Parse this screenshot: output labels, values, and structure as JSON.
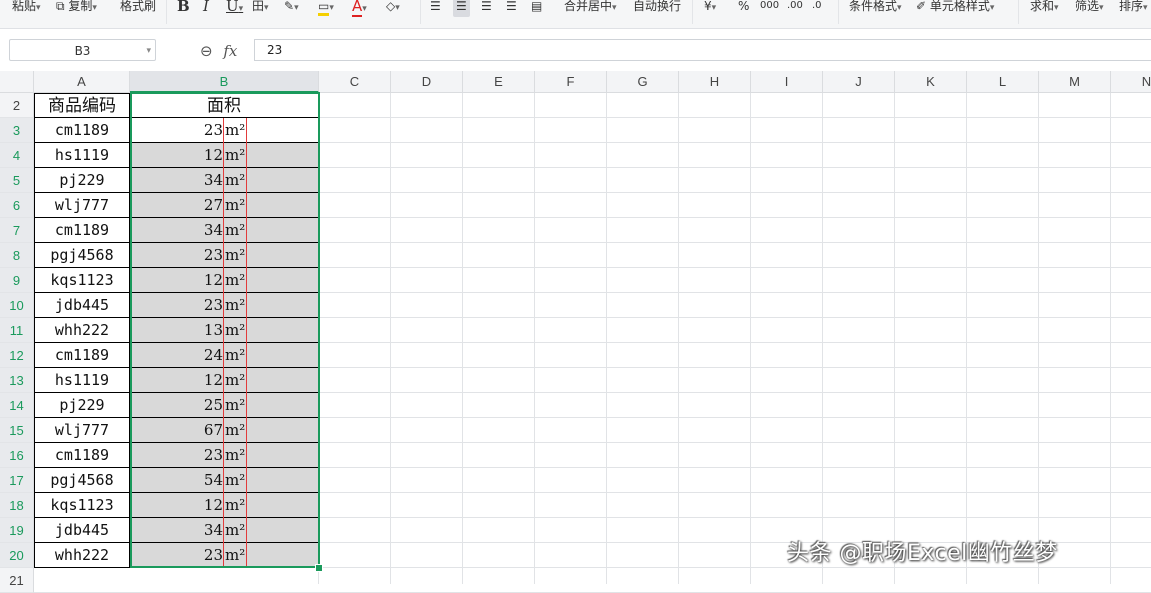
{
  "ribbon": {
    "items": [
      {
        "label": "粘贴",
        "caret": true
      },
      {
        "label": "复制",
        "caret": true,
        "icon": "copy-icon"
      },
      {
        "label": "格式刷"
      },
      {
        "label": "B"
      },
      {
        "label": "I"
      },
      {
        "label": "U",
        "caret": true
      },
      {
        "label": "田",
        "caret": true
      },
      {
        "label": "✎",
        "caret": true
      },
      {
        "label": "A",
        "caret": true
      },
      {
        "label": "◇",
        "caret": true
      },
      {
        "label": "合并居中",
        "caret": true
      },
      {
        "label": "自动换行"
      },
      {
        "label": "¥",
        "caret": true
      },
      {
        "label": "%"
      },
      {
        "label": "条件格式",
        "caret": true
      },
      {
        "label": "单元格样式",
        "caret": true
      },
      {
        "label": "求和",
        "caret": true
      },
      {
        "label": "筛选",
        "caret": true
      },
      {
        "label": "排序",
        "caret": true
      }
    ]
  },
  "formula_bar": {
    "name_box": "B3",
    "fx_label": "fx",
    "value": "23"
  },
  "columns": [
    "A",
    "B",
    "C",
    "D",
    "E",
    "F",
    "G",
    "H",
    "I",
    "J",
    "K",
    "L",
    "M",
    "N"
  ],
  "selected_column": "B",
  "row_numbers": [
    "2",
    "3",
    "4",
    "5",
    "6",
    "7",
    "8",
    "9",
    "10",
    "11",
    "12",
    "13",
    "14",
    "15",
    "16",
    "17",
    "18",
    "19",
    "20",
    "21"
  ],
  "headers": {
    "code": "商品编码",
    "area": "面积"
  },
  "unit": "m²",
  "rows": [
    {
      "code": "cm1189",
      "area": "23"
    },
    {
      "code": "hs1119",
      "area": "12"
    },
    {
      "code": "pj229",
      "area": "34"
    },
    {
      "code": "wlj777",
      "area": "27"
    },
    {
      "code": "cm1189",
      "area": "34"
    },
    {
      "code": "pgj4568",
      "area": "23"
    },
    {
      "code": "kqs1123",
      "area": "12"
    },
    {
      "code": "jdb445",
      "area": "23"
    },
    {
      "code": "whh222",
      "area": "13"
    },
    {
      "code": "cm1189",
      "area": "24"
    },
    {
      "code": "hs1119",
      "area": "12"
    },
    {
      "code": "pj229",
      "area": "25"
    },
    {
      "code": "wlj777",
      "area": "67"
    },
    {
      "code": "cm1189",
      "area": "23"
    },
    {
      "code": "pgj4568",
      "area": "54"
    },
    {
      "code": "kqs1123",
      "area": "12"
    },
    {
      "code": "jdb445",
      "area": "34"
    },
    {
      "code": "whh222",
      "area": "23"
    }
  ],
  "watermark": "头条 @职场Excel幽竹丝梦",
  "colors": {
    "selection": "#1a9a5c",
    "selected_fill": "#d9d9d9",
    "unit_border": "#e23b3b"
  }
}
